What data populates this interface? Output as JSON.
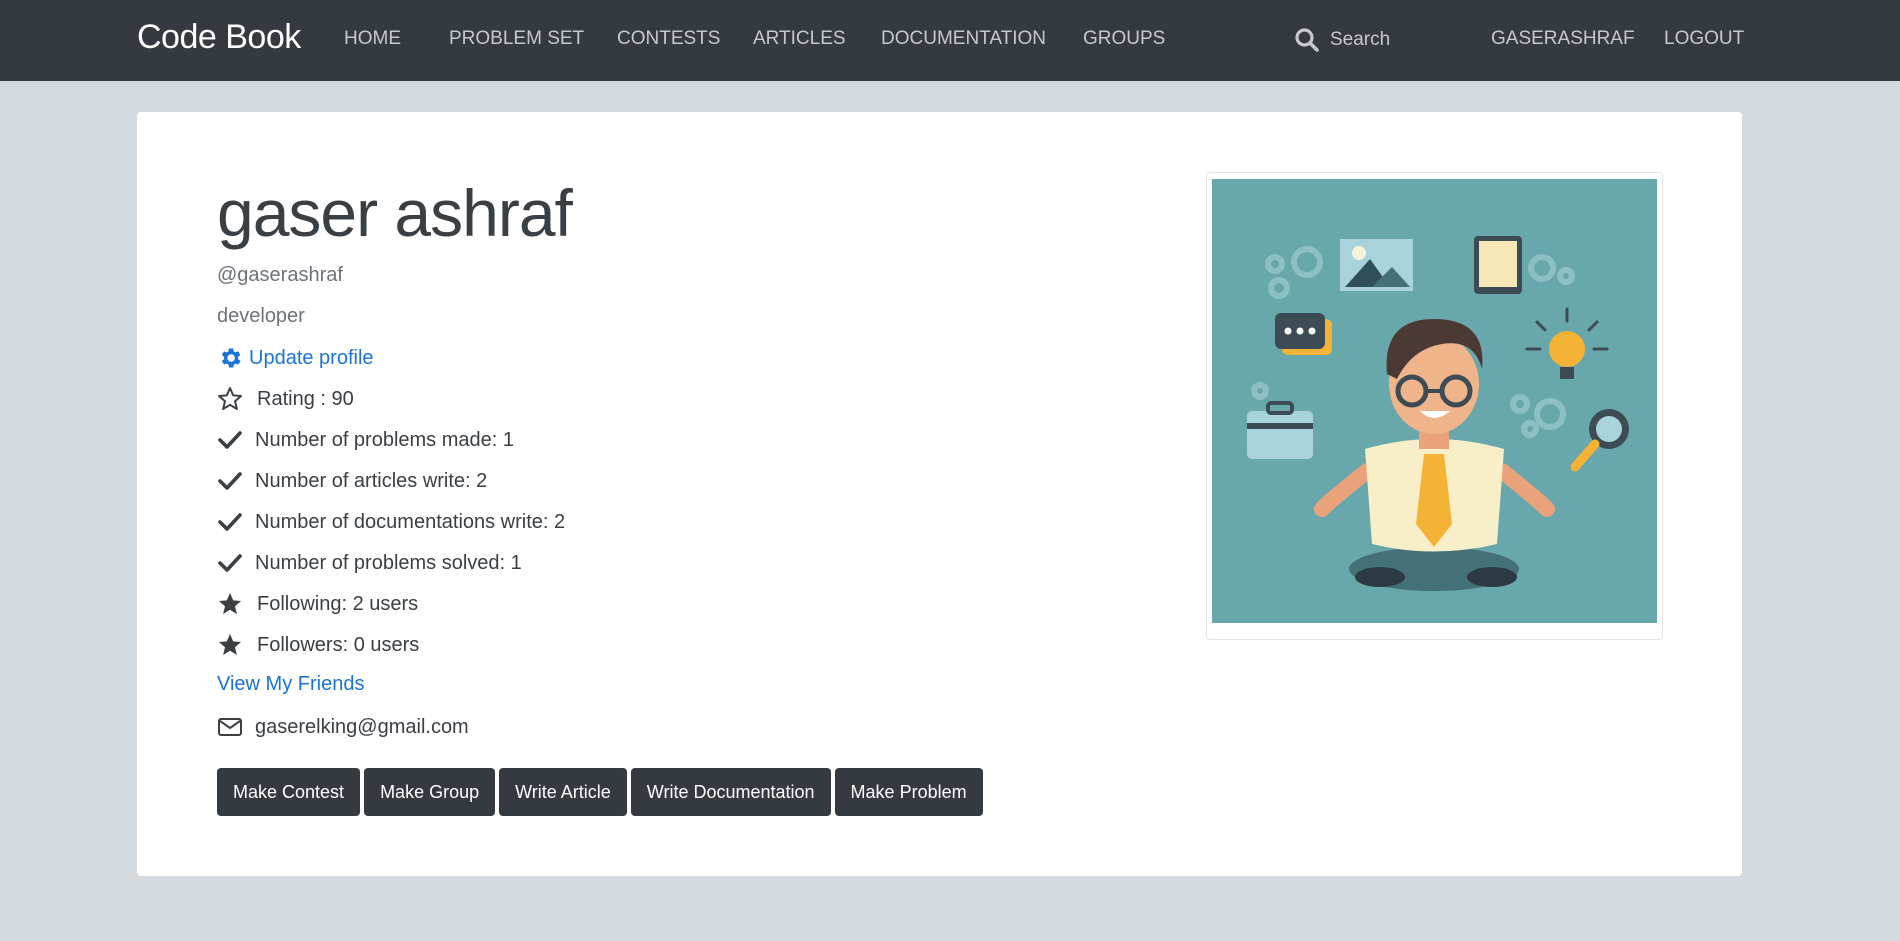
{
  "navbar": {
    "brand": "Code Book",
    "links": [
      "HOME",
      "PROBLEM SET",
      "CONTESTS",
      "ARTICLES",
      "DOCUMENTATION",
      "GROUPS"
    ],
    "search_placeholder": "Search",
    "user": "GASERASHRAF",
    "logout": "LOGOUT"
  },
  "profile": {
    "name": "gaser ashraf",
    "handle": "@gaserashraf",
    "role": "developer",
    "update_profile": "Update profile",
    "rating": "Rating : 90",
    "problems_made": "Number of problems made: 1",
    "articles_written": "Number of articles write: 2",
    "documentations_written": "Number of documentations write: 2",
    "problems_solved": "Number of problems solved: 1",
    "following": "Following: 2 users",
    "followers": "Followers: 0 users",
    "view_friends": "View My Friends",
    "email": "gaserelking@gmail.com"
  },
  "actions": [
    "Make Contest",
    "Make Group",
    "Write Article",
    "Write Documentation",
    "Make Problem"
  ],
  "icons": {
    "search": "search-icon",
    "update": "gear-icon",
    "rating": "star-outline-icon",
    "check": "check-icon",
    "star": "star-icon",
    "email": "envelope-icon"
  },
  "colors": {
    "navbar": "#343a40",
    "link": "#1a73d9",
    "background": "#d5dadf",
    "avatar_bg": "#68a8ad"
  }
}
